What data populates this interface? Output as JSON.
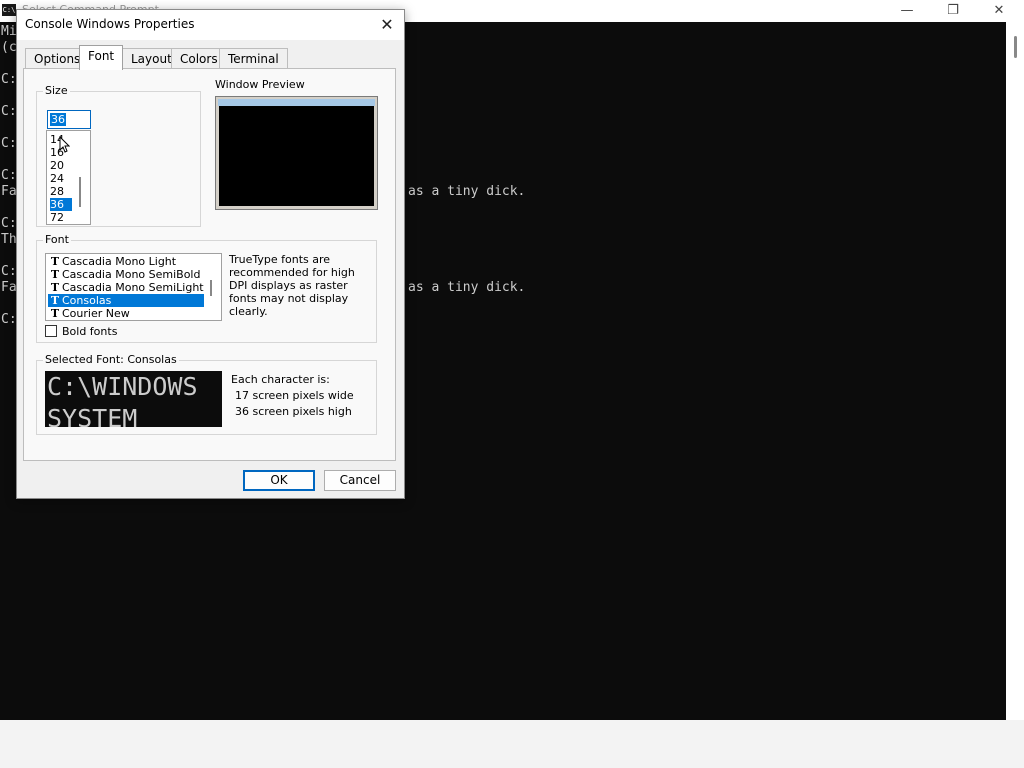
{
  "console": {
    "title": "Select Command Prompt",
    "icon_text": "C:\\",
    "minimize_glyph": "—",
    "maximize_glyph": "❐",
    "close_glyph": "✕",
    "lines": [
      "Mi",
      "(c",
      "C:",
      "C:",
      "C:",
      "C:",
      "Fa                                                  as a tiny dick.",
      "C:",
      "Th",
      "C:",
      "Fa                                                  as a tiny dick.",
      "C:"
    ]
  },
  "dialog": {
    "title": "Console Windows Properties",
    "close_glyph": "✕",
    "tabs": [
      "Options",
      "Font",
      "Layout",
      "Colors",
      "Terminal"
    ],
    "active_tab": "Font",
    "size": {
      "label": "Size",
      "value": "36",
      "items": [
        "14",
        "16",
        "20",
        "24",
        "28",
        "36",
        "72"
      ],
      "selected": "36"
    },
    "preview": {
      "label": "Window Preview"
    },
    "font": {
      "label": "Font",
      "items": [
        "Cascadia Mono Light",
        "Cascadia Mono SemiBold",
        "Cascadia Mono SemiLight",
        "Consolas",
        "Courier New"
      ],
      "selected": "Consolas",
      "truetype_icon": "T",
      "note": "TrueType fonts are recommended for high DPI displays as raster fonts may not display clearly.",
      "bold_label": "Bold fonts",
      "bold_checked": false
    },
    "selected_font": {
      "label": "Selected Font: Consolas",
      "sample_line1": "C:\\WINDOWS",
      "sample_line2": "SYSTEM",
      "char_info_title": "Each character is:",
      "char_width": "17 screen pixels wide",
      "char_height": "36 screen pixels high"
    },
    "buttons": {
      "ok": "OK",
      "cancel": "Cancel"
    }
  }
}
